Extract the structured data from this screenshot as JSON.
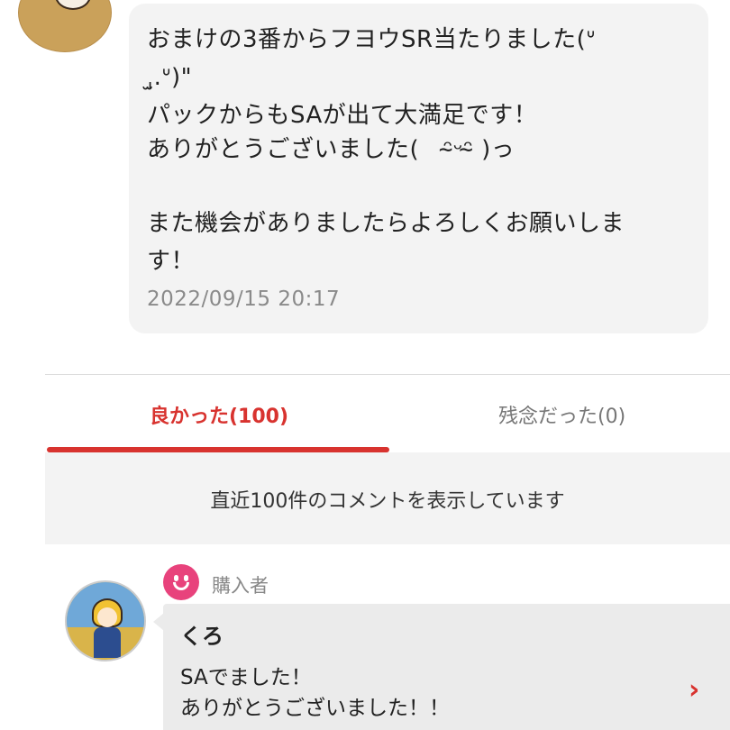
{
  "review": {
    "message_lines": [
      "おまけの3番からフヨウSR当たりました(ᐡ",
      "ˌ̫.ᐡ)\"",
      "パックからもSAが出て大満足です！",
      "ありがとうございました(　ᵔ̴ᵕᵔ̴ )っ",
      "",
      "また機会がありましたらよろしくお願いしま",
      "す！"
    ],
    "timestamp": "2022/09/15 20:17"
  },
  "tabs": [
    {
      "label": "良かった(100)",
      "active": true
    },
    {
      "label": "残念だった(0)",
      "active": false
    }
  ],
  "notice": {
    "text": "直近100件のコメントを表示しています"
  },
  "comment": {
    "buyer_label": "購入者",
    "user_name": "くろ",
    "lines": [
      "SAでました！",
      "ありがとうございました！！"
    ]
  },
  "icons": {
    "buyer_badge": "smiley-face-icon",
    "expand": "chevron-right-icon"
  },
  "colors": {
    "accent": "#d8332f",
    "buyer_badge": "#e8427c",
    "bubble_bg": "#f3f3f3"
  }
}
